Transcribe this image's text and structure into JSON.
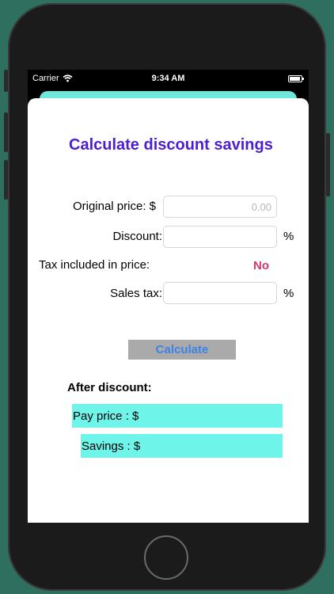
{
  "status_bar": {
    "carrier": "Carrier",
    "time": "9:34 AM"
  },
  "title": "Calculate discount savings",
  "form": {
    "original_price_label": "Original price: $",
    "original_price_placeholder": "0.00",
    "discount_label": "Discount:",
    "percent_symbol": "%",
    "tax_included_label": "Tax included in price:",
    "tax_included_value": "No",
    "sales_tax_label": "Sales tax:"
  },
  "calculate_label": "Calculate",
  "results": {
    "heading": "After discount:",
    "pay_price_label": "Pay price : $",
    "savings_label": "Savings : $"
  },
  "colors": {
    "title": "#4b1fd0",
    "accent_cyan": "#6ff4ea",
    "no_value": "#d3386a",
    "button_text": "#3d82e6",
    "button_bg": "#aaaaaa"
  },
  "icons": [
    "wifi-icon",
    "battery-icon"
  ]
}
